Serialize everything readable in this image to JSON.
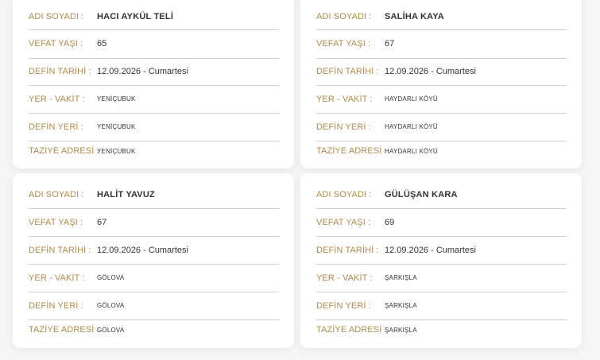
{
  "labels": {
    "name": "ADI SOYADI :",
    "age": "VEFAT YAŞI :",
    "burial_date": "DEFİN TARİHİ :",
    "place_time": "YER - VAKİT :",
    "burial_place": "DEFİN YERİ :",
    "condolence_address": "TAZİYE ADRESİ :"
  },
  "cards": [
    {
      "name": "HACI AYKÜL TELİ",
      "age": "65",
      "burial_date": "12.09.2026 - Cumartesi",
      "place_time": "YENİÇUBUK",
      "burial_place": "YENİÇUBUK",
      "condolence_address": "YENİÇUBUK"
    },
    {
      "name": "SALİHA KAYA",
      "age": "67",
      "burial_date": "12.09.2026 - Cumartesi",
      "place_time": "HAYDARLI KÖYÜ",
      "burial_place": "HAYDARLI KÖYÜ",
      "condolence_address": "HAYDARLI KÖYÜ"
    },
    {
      "name": "HALİT YAVUZ",
      "age": "67",
      "burial_date": "12.09.2026 - Cumartesi",
      "place_time": "GÖLOVA",
      "burial_place": "GÖLOVA",
      "condolence_address": "GÖLOVA"
    },
    {
      "name": "GÜLÜŞAN KARA",
      "age": "69",
      "burial_date": "12.09.2026 - Cumartesi",
      "place_time": "ŞARKIŞLA",
      "burial_place": "ŞARKIŞLA",
      "condolence_address": "ŞARKIŞLA"
    }
  ]
}
